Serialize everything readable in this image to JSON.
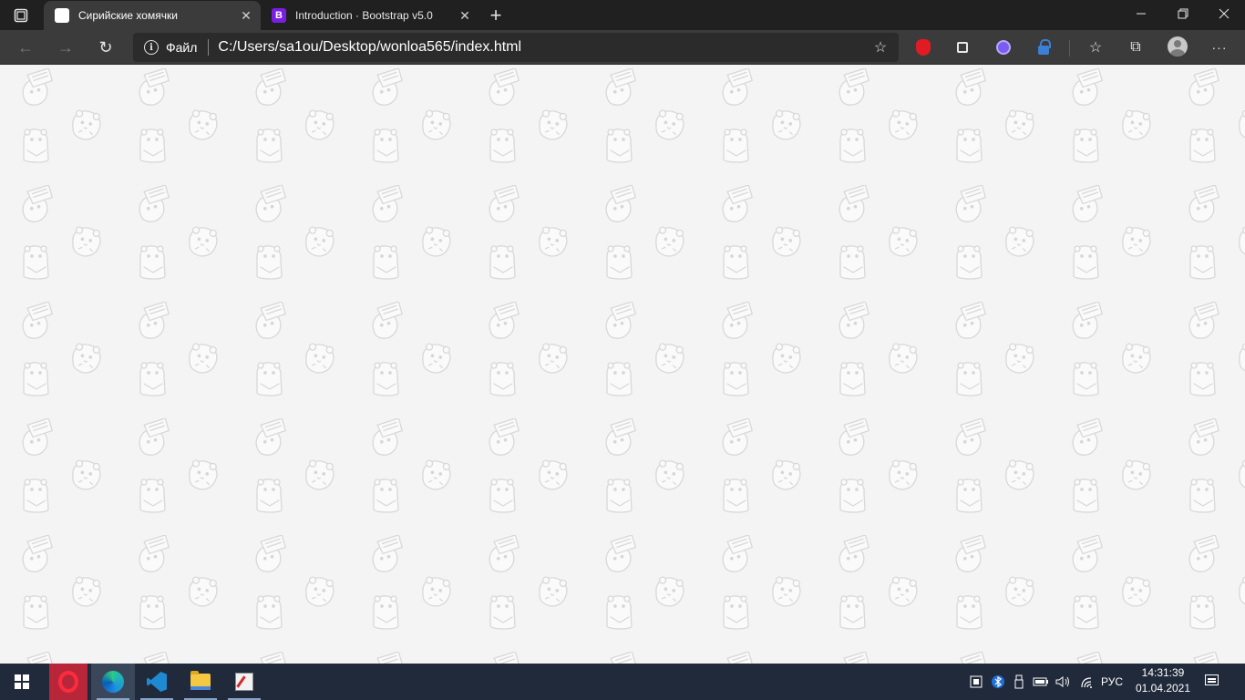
{
  "browser": {
    "tabs": [
      {
        "title": "Сирийские хомячки",
        "favicon": "hamster-favicon",
        "active": true
      },
      {
        "title": "Introduction · Bootstrap v5.0",
        "favicon": "bootstrap-favicon",
        "favicon_letter": "B",
        "active": false
      }
    ],
    "address": {
      "scheme_label": "Файл",
      "url": "C:/Users/sa1ou/Desktop/wonloa565/index.html"
    },
    "window_controls": {
      "minimize": "—",
      "restore": "❐",
      "close": "✕"
    },
    "toolbar_icons": {
      "back": "←",
      "forward": "→",
      "refresh": "↻",
      "add_favorite": "☆",
      "favorites": "☆",
      "collections": "⧉",
      "more": "···"
    },
    "new_tab": "+",
    "tab_close": "✕"
  },
  "page": {
    "background_color": "#f4f4f4",
    "pattern": "hamster-sketch-pattern"
  },
  "taskbar": {
    "apps": [
      "start",
      "opera",
      "edge",
      "vscode",
      "file-explorer",
      "paint"
    ],
    "tray": {
      "language": "РУС",
      "time": "14:31:39",
      "date": "01.04.2021"
    }
  },
  "colors": {
    "tabstrip": "#202020",
    "toolbar": "#3b3b3b",
    "taskbar": "#202a3a",
    "opera_accent": "#b8263a",
    "bootstrap_purple": "#7a1ee0"
  }
}
